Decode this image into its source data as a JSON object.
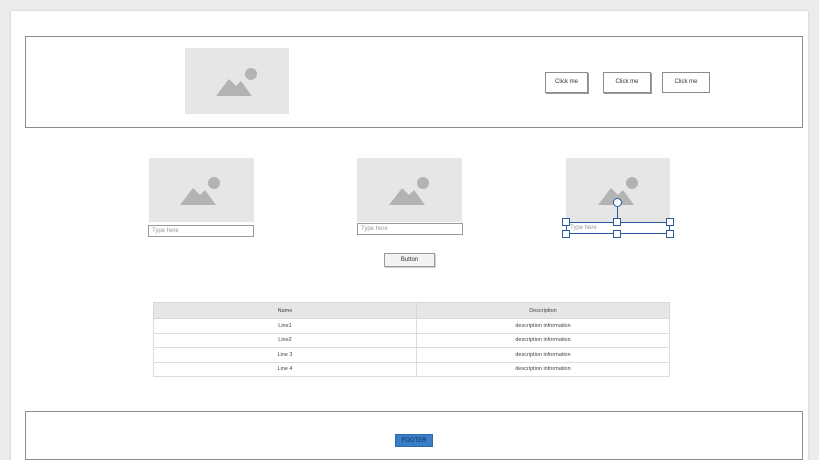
{
  "header": {
    "buttons": [
      {
        "label": "Click me"
      },
      {
        "label": "Click me"
      },
      {
        "label": "Click me"
      }
    ]
  },
  "cards": [
    {
      "input_placeholder": "Type here"
    },
    {
      "input_placeholder": "Type here"
    },
    {
      "input_placeholder": "Type here"
    }
  ],
  "center_button": {
    "label": "Button"
  },
  "table": {
    "headers": [
      "Name",
      "Description"
    ],
    "rows": [
      [
        "Line1",
        "description information"
      ],
      [
        "Line2",
        "description information"
      ],
      [
        "Line 3",
        "description information"
      ],
      [
        "Line 4",
        "description information"
      ]
    ]
  },
  "footer": {
    "label": "FOOTER"
  },
  "colors": {
    "accent": "#3a7dc9",
    "selection": "#2c5aa0",
    "placeholder_bg": "#e6e6e6",
    "placeholder_icon": "#b3b3b3"
  },
  "icons": {
    "image_placeholder": "image-placeholder-icon"
  }
}
